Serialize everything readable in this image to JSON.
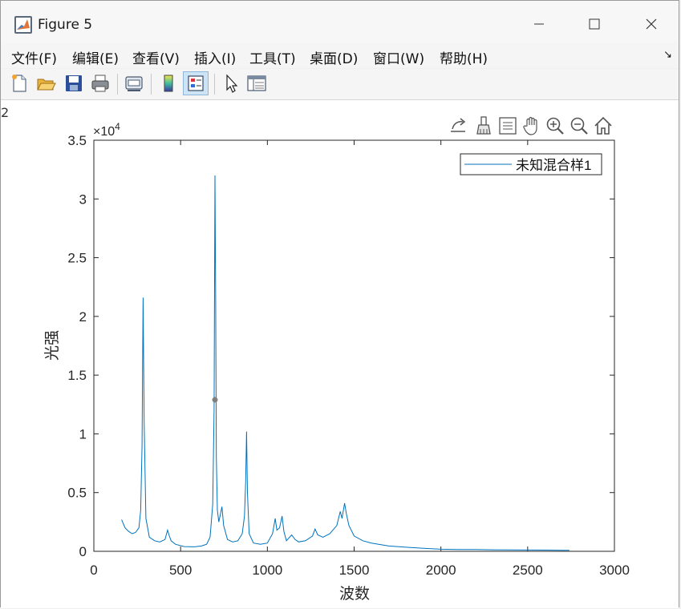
{
  "window": {
    "title": "Figure 5",
    "controls": [
      "minimize-icon",
      "maximize-icon",
      "close-icon"
    ]
  },
  "menu": [
    "文件(F)",
    "编辑(E)",
    "查看(V)",
    "插入(I)",
    "工具(T)",
    "桌面(D)",
    "窗口(W)",
    "帮助(H)"
  ],
  "menu_overflow_icon": "dock-arrow-icon",
  "toolbar": [
    "new-figure-icon",
    "open-file-icon",
    "save-icon",
    "print-icon",
    "link-plot-icon",
    "colorbar-icon",
    "legend-icon",
    "edit-plot-icon",
    "property-inspector-icon"
  ],
  "axes_toolbar": [
    "export-icon",
    "brush-icon",
    "data-tip-icon",
    "pan-icon",
    "zoom-in-icon",
    "zoom-out-icon",
    "home-icon"
  ],
  "colors": {
    "line": "#0072bd",
    "marker": "#808080",
    "axis": "#262626"
  },
  "chart_data": {
    "type": "line",
    "xlabel": "波数",
    "ylabel": "光强",
    "y_exponent_label": "×10",
    "y_exponent": "4",
    "xlim": [
      0,
      3000
    ],
    "ylim": [
      0,
      35000
    ],
    "xticks": [
      0,
      500,
      1000,
      1500,
      2000,
      2500,
      3000
    ],
    "yticks": [
      0,
      5000,
      10000,
      15000,
      20000,
      25000,
      30000,
      35000
    ],
    "ytick_labels": [
      "0",
      "0.5",
      "1",
      "1.5",
      "2",
      "2.5",
      "3",
      "3.5"
    ],
    "legend": {
      "position": "top-right",
      "entry": "未知混合样1"
    },
    "series": [
      {
        "name": "未知混合样1",
        "x": [
          160,
          180,
          200,
          220,
          240,
          260,
          270,
          278,
          284,
          290,
          300,
          320,
          350,
          380,
          410,
          425,
          435,
          445,
          470,
          520,
          580,
          620,
          650,
          670,
          685,
          693,
          698,
          702,
          706,
          712,
          720,
          730,
          738,
          748,
          770,
          800,
          830,
          855,
          868,
          875,
          880,
          885,
          895,
          920,
          960,
          1000,
          1030,
          1045,
          1055,
          1070,
          1085,
          1095,
          1110,
          1140,
          1160,
          1180,
          1220,
          1260,
          1275,
          1290,
          1320,
          1360,
          1400,
          1420,
          1430,
          1445,
          1455,
          1470,
          1500,
          1550,
          1600,
          1700,
          1800,
          1900,
          2000,
          2100,
          2200,
          2300,
          2400,
          2500,
          2600,
          2700,
          2740
        ],
        "y": [
          2700,
          2000,
          1700,
          1500,
          1600,
          2000,
          3500,
          9000,
          21600,
          11000,
          2800,
          1200,
          900,
          800,
          1000,
          1800,
          1300,
          900,
          600,
          400,
          380,
          450,
          600,
          1200,
          4000,
          12000,
          32000,
          21000,
          8000,
          3500,
          2500,
          3200,
          3800,
          2200,
          1000,
          800,
          900,
          1500,
          3000,
          6000,
          10200,
          5000,
          1500,
          700,
          600,
          700,
          1500,
          2800,
          1800,
          2000,
          3000,
          1700,
          900,
          1400,
          1000,
          800,
          900,
          1300,
          1900,
          1400,
          1200,
          1500,
          2200,
          3400,
          2800,
          4100,
          3200,
          2200,
          1300,
          900,
          700,
          450,
          350,
          250,
          180,
          160,
          150,
          130,
          120,
          110,
          100,
          90,
          80
        ]
      }
    ],
    "data_tip": {
      "x": 698,
      "y": 12900
    }
  }
}
